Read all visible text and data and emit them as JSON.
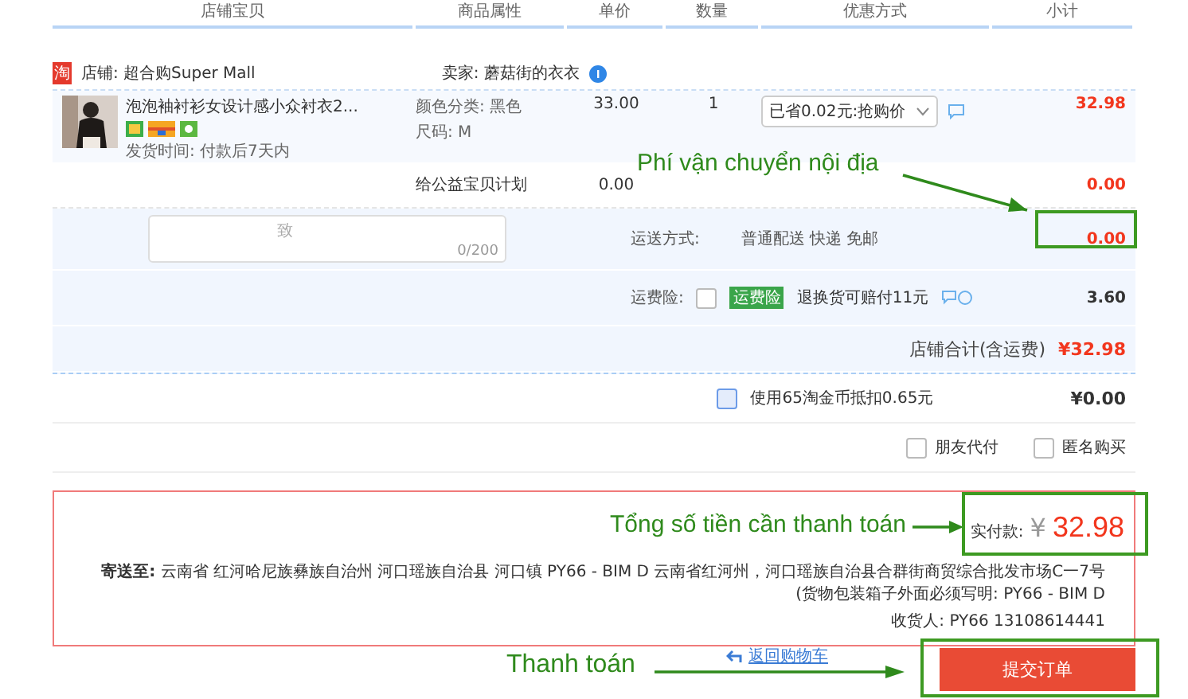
{
  "columns": [
    "店铺宝贝",
    "商品属性",
    "单价",
    "数量",
    "优惠方式",
    "小计"
  ],
  "store": {
    "logo": "淘",
    "name": "店铺: 超合购Super Mall",
    "seller": "卖家: 蘑菇街的衣衣"
  },
  "item": {
    "title": "泡泡袖衬衫女设计感小众衬衣2...",
    "delivery": "发货时间: 付款后7天内",
    "attributes": [
      "颜色分类: 黑色",
      "尺码: M"
    ],
    "price": "33.00",
    "quantity": "1",
    "discount": "已省0.02元:抢购价",
    "subtotal": "32.98"
  },
  "charity": {
    "label": "给公益宝贝计划",
    "price": "0.00",
    "subtotal": "0.00"
  },
  "note": {
    "placeholder": "致",
    "counter": "0/200"
  },
  "shipping": {
    "label": "运送方式:",
    "value": "普通配送 快递 免邮",
    "fee": "0.00"
  },
  "insurance": {
    "label": "运费险:",
    "checked": false,
    "tag": "运费险",
    "text": "退换货可赔付11元",
    "fee": "3.60"
  },
  "store_total": {
    "label": "店铺合计(含运费)",
    "amount": "¥32.98"
  },
  "coins": {
    "label": "使用65淘金币抵扣0.65元",
    "checked": false,
    "amount": "¥0.00"
  },
  "options": [
    {
      "label": "朋友代付",
      "checked": false
    },
    {
      "label": "匿名购买",
      "checked": false
    }
  ],
  "summary": {
    "paid_label": "实付款:",
    "currency": "¥",
    "amount": "32.98",
    "address_label": "寄送至:",
    "address": "云南省 红河哈尼族彝族自治州 河口瑶族自治县 河口镇 PY66 - BIM D 云南省红河州，河口瑶族自治县合群街商贸综合批发市场C一7号 (货物包装箱子外面必须写明: PY66 - BIM D",
    "recipient": "收货人: PY66 13108614441"
  },
  "actions": {
    "back_link": "返回购物车",
    "submit": "提交订单"
  },
  "annotations": [
    {
      "kind": "shipping",
      "text": "Phí vận chuyển nội địa"
    },
    {
      "kind": "total",
      "text": "Tổng số tiền cần thanh toán"
    },
    {
      "kind": "pay",
      "text": "Thanh toán"
    }
  ]
}
